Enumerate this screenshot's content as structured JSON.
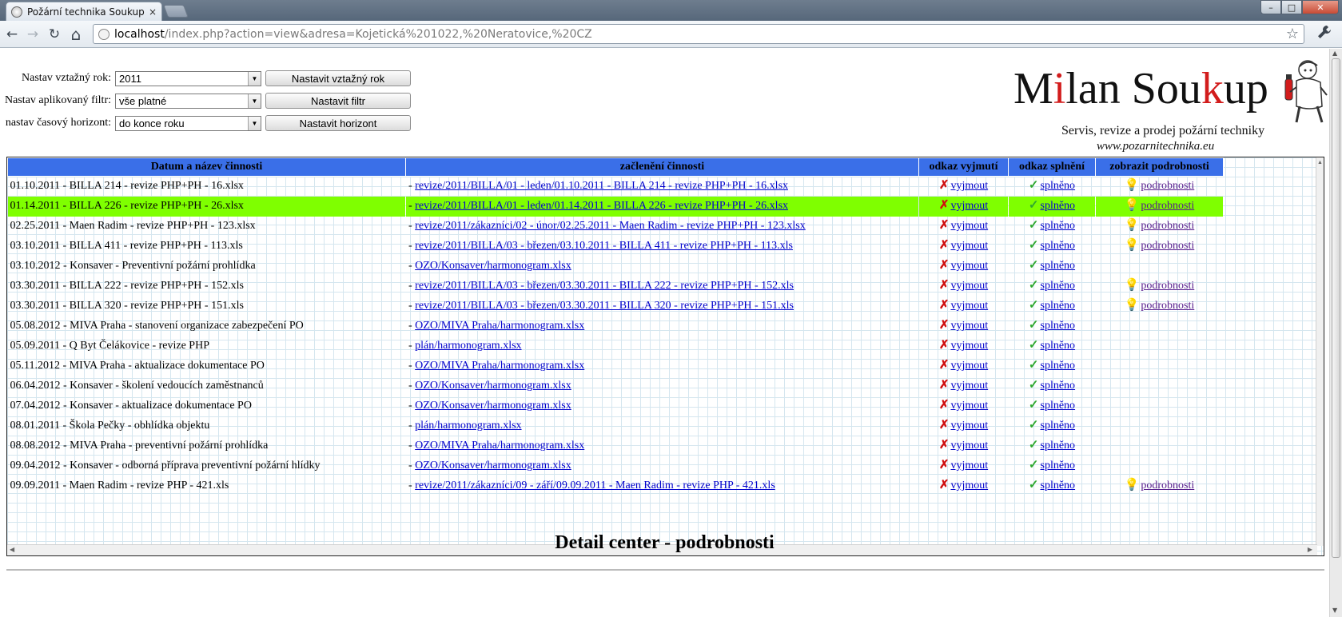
{
  "browser": {
    "tab_title": "Požární technika Soukup",
    "tab_close": "×",
    "url_host": "localhost",
    "url_rest": "/index.php?action=view&adresa=Kojetická%201022,%20Neratovice,%20CZ",
    "back": "←",
    "forward": "→",
    "reload": "↻",
    "home": "⌂",
    "star": "☆",
    "wrench": "🔧",
    "min": "–",
    "max": "□",
    "close": "✕"
  },
  "form": {
    "year_label": "Nastav vztažný rok:",
    "year_value": "2011",
    "year_button": "Nastavit vztažný rok",
    "filter_label": "Nastav aplikovaný filtr:",
    "filter_value": "vše platné",
    "filter_button": "Nastavit filtr",
    "horizon_label": "nastav časový horizont:",
    "horizon_value": "do konce roku",
    "horizon_button": "Nastavit horizont"
  },
  "logo": {
    "brand_m": "M",
    "brand_i": "i",
    "brand_lan": "lan Sou",
    "brand_k": "k",
    "brand_up": "up",
    "tagline": "Servis, revize a prodej požární techniky",
    "web": "www.pozarnitechnika.eu"
  },
  "table": {
    "headers": [
      "Datum a název činnosti",
      "začlenění činnosti",
      "odkaz vyjmutí",
      "odkaz splnění",
      "zobrazit podrobnosti"
    ],
    "link_vyjmout": "vyjmout",
    "link_splneno": "splněno",
    "link_podrobnosti": "podrobnosti",
    "rows": [
      {
        "name": "01.10.2011 - BILLA 214 - revize PHP+PH - 16.xlsx",
        "path": "revize/2011/BILLA/01 - leden/01.10.2011 - BILLA 214 - revize PHP+PH - 16.xlsx",
        "details": true,
        "highlight": false
      },
      {
        "name": "01.14.2011 - BILLA 226 - revize PHP+PH - 26.xlsx",
        "path": "revize/2011/BILLA/01 - leden/01.14.2011 - BILLA 226 - revize PHP+PH - 26.xlsx",
        "details": true,
        "highlight": true
      },
      {
        "name": "02.25.2011 - Maen Radim - revize PHP+PH - 123.xlsx",
        "path": "revize/2011/zákazníci/02 - únor/02.25.2011 - Maen Radim - revize PHP+PH - 123.xlsx",
        "details": true,
        "highlight": false
      },
      {
        "name": "03.10.2011 - BILLA 411 - revize PHP+PH - 113.xls",
        "path": "revize/2011/BILLA/03 - březen/03.10.2011 - BILLA 411 - revize PHP+PH - 113.xls",
        "details": true,
        "highlight": false
      },
      {
        "name": "03.10.2012 - Konsaver - Preventivní požární prohlídka",
        "path": "OZO/Konsaver/harmonogram.xlsx",
        "details": false,
        "highlight": false
      },
      {
        "name": "03.30.2011 - BILLA 222 - revize PHP+PH - 152.xls",
        "path": "revize/2011/BILLA/03 - březen/03.30.2011 - BILLA 222 - revize PHP+PH - 152.xls",
        "details": true,
        "highlight": false
      },
      {
        "name": "03.30.2011 - BILLA 320 - revize PHP+PH - 151.xls",
        "path": "revize/2011/BILLA/03 - březen/03.30.2011 - BILLA 320 - revize PHP+PH - 151.xls",
        "details": true,
        "highlight": false
      },
      {
        "name": "05.08.2012 - MIVA Praha - stanovení organizace zabezpečení PO",
        "path": "OZO/MIVA Praha/harmonogram.xlsx",
        "details": false,
        "highlight": false
      },
      {
        "name": "05.09.2011 - Q Byt Čelákovice - revize PHP",
        "path": "plán/harmonogram.xlsx",
        "details": false,
        "highlight": false
      },
      {
        "name": "05.11.2012 - MIVA Praha - aktualizace dokumentace PO",
        "path": "OZO/MIVA Praha/harmonogram.xlsx",
        "details": false,
        "highlight": false
      },
      {
        "name": "06.04.2012 - Konsaver - školení vedoucích zaměstnanců",
        "path": "OZO/Konsaver/harmonogram.xlsx",
        "details": false,
        "highlight": false
      },
      {
        "name": "07.04.2012 - Konsaver - aktualizace dokumentace PO",
        "path": "OZO/Konsaver/harmonogram.xlsx",
        "details": false,
        "highlight": false
      },
      {
        "name": "08.01.2011 - Škola Pečky - obhlídka objektu",
        "path": "plán/harmonogram.xlsx",
        "details": false,
        "highlight": false
      },
      {
        "name": "08.08.2012 - MIVA Praha - preventivní požární prohlídka",
        "path": "OZO/MIVA Praha/harmonogram.xlsx",
        "details": false,
        "highlight": false
      },
      {
        "name": "09.04.2012 - Konsaver - odborná příprava preventivní požární hlídky",
        "path": "OZO/Konsaver/harmonogram.xlsx",
        "details": false,
        "highlight": false
      },
      {
        "name": "09.09.2011 - Maen Radim - revize PHP - 421.xls",
        "path": "revize/2011/zákazníci/09 - září/09.09.2011 - Maen Radim - revize PHP - 421.xls",
        "details": true,
        "highlight": false
      }
    ]
  },
  "detail_title": "Detail center - podrobnosti",
  "colors": {
    "header_bg": "#3a6fe8",
    "highlight_row": "#7fff00",
    "logo_red": "#d21c1c"
  }
}
